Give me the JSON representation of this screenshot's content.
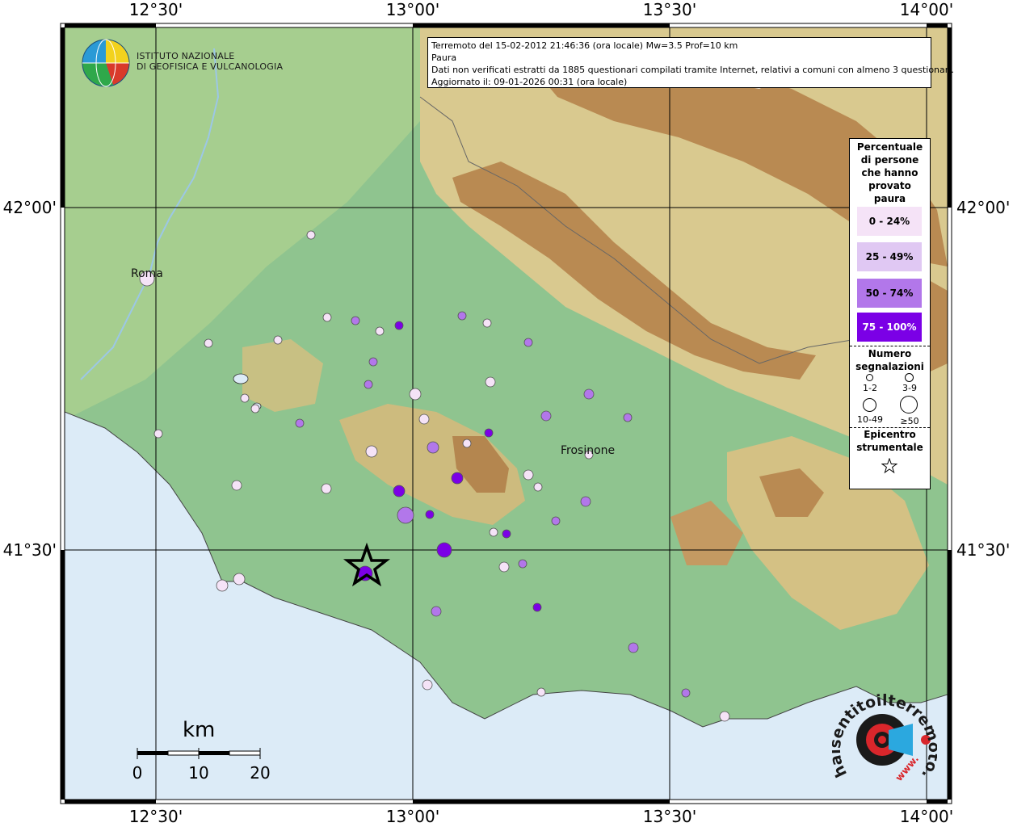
{
  "map": {
    "lon_ticks": [
      "12°30'",
      "13°00'",
      "13°30'",
      "14°00'"
    ],
    "lat_ticks": [
      "42°00'",
      "41°30'"
    ],
    "colors": {
      "land": "#8fc48f",
      "sea": "#dcebf7",
      "hills": "#d8c28a",
      "mountains": "#b98a52"
    },
    "cities": [
      {
        "name": "Roma"
      },
      {
        "name": "Frosinone"
      }
    ],
    "epicenter_icon": "star-icon"
  },
  "header": {
    "logo_icon": "globe-logo-icon",
    "logo_line1": "ISTITUTO NAZIONALE",
    "logo_line2": "DI GEOFISICA E VULCANOLOGIA"
  },
  "info": {
    "line1": "Terremoto del 15-02-2012 21:46:36 (ora locale) Mw=3.5 Prof=10 km",
    "line2": "Paura",
    "line3": "Dati non verificati estratti da 1885 questionari compilati tramite Internet, relativi a comuni con almeno 3 questionari.",
    "line4": "Aggiornato il: 09-01-2026 00:31 (ora locale)"
  },
  "legend": {
    "title_lines": [
      "Percentuale",
      "di persone",
      "che hanno",
      "provato",
      "paura"
    ],
    "classes": [
      {
        "label": "0 - 24%",
        "color": "#f5e3f7"
      },
      {
        "label": "25 - 49%",
        "color": "#e0c8f3"
      },
      {
        "label": "50 - 74%",
        "color": "#b277ea"
      },
      {
        "label": "75 - 100%",
        "color": "#7b00e6"
      }
    ],
    "count_title_lines": [
      "Numero",
      "segnalazioni"
    ],
    "counts": [
      "1-2",
      "3-9",
      "10-49",
      "≥50"
    ],
    "epicenter_title_lines": [
      "Epicentro",
      "strumentale"
    ]
  },
  "scale": {
    "unit": "km",
    "labels": [
      "0",
      "10",
      "20"
    ]
  },
  "badge": {
    "text": "haisentitoilterremoto.it",
    "prefix": "www.",
    "icon": "megaphone-icon"
  }
}
